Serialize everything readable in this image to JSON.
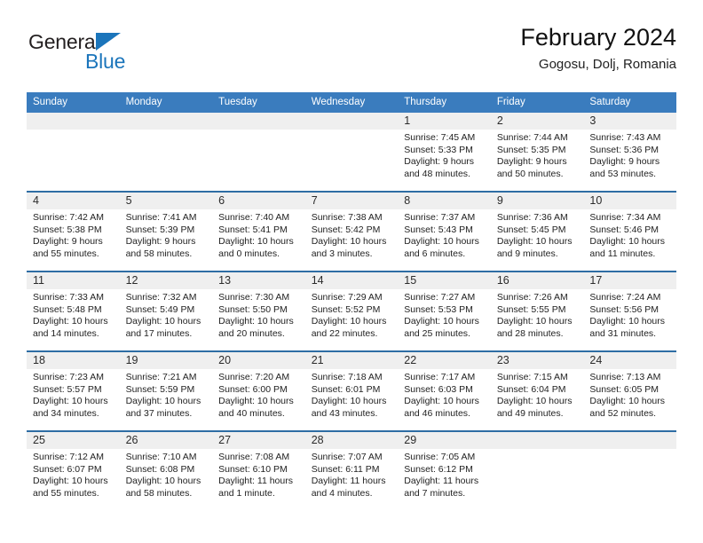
{
  "brand": {
    "word_one": "General",
    "word_two": "Blue",
    "triangle_icon": "triangle-icon",
    "accent_color": "#1b75bb"
  },
  "header": {
    "title": "February 2024",
    "location": "Gogosu, Dolj, Romania"
  },
  "theme": {
    "header_blue": "#3a7cbe",
    "row_rule_blue": "#2e6da4",
    "daynum_band": "#efefef"
  },
  "weekday_headers": [
    "Sunday",
    "Monday",
    "Tuesday",
    "Wednesday",
    "Thursday",
    "Friday",
    "Saturday"
  ],
  "weeks": [
    [
      {
        "day": "",
        "sunrise": "",
        "sunset": "",
        "daylight_1": "",
        "daylight_2": "",
        "empty": true
      },
      {
        "day": "",
        "sunrise": "",
        "sunset": "",
        "daylight_1": "",
        "daylight_2": "",
        "empty": true
      },
      {
        "day": "",
        "sunrise": "",
        "sunset": "",
        "daylight_1": "",
        "daylight_2": "",
        "empty": true
      },
      {
        "day": "",
        "sunrise": "",
        "sunset": "",
        "daylight_1": "",
        "daylight_2": "",
        "empty": true
      },
      {
        "day": "1",
        "sunrise": "Sunrise: 7:45 AM",
        "sunset": "Sunset: 5:33 PM",
        "daylight_1": "Daylight: 9 hours",
        "daylight_2": "and 48 minutes."
      },
      {
        "day": "2",
        "sunrise": "Sunrise: 7:44 AM",
        "sunset": "Sunset: 5:35 PM",
        "daylight_1": "Daylight: 9 hours",
        "daylight_2": "and 50 minutes."
      },
      {
        "day": "3",
        "sunrise": "Sunrise: 7:43 AM",
        "sunset": "Sunset: 5:36 PM",
        "daylight_1": "Daylight: 9 hours",
        "daylight_2": "and 53 minutes."
      }
    ],
    [
      {
        "day": "4",
        "sunrise": "Sunrise: 7:42 AM",
        "sunset": "Sunset: 5:38 PM",
        "daylight_1": "Daylight: 9 hours",
        "daylight_2": "and 55 minutes."
      },
      {
        "day": "5",
        "sunrise": "Sunrise: 7:41 AM",
        "sunset": "Sunset: 5:39 PM",
        "daylight_1": "Daylight: 9 hours",
        "daylight_2": "and 58 minutes."
      },
      {
        "day": "6",
        "sunrise": "Sunrise: 7:40 AM",
        "sunset": "Sunset: 5:41 PM",
        "daylight_1": "Daylight: 10 hours",
        "daylight_2": "and 0 minutes."
      },
      {
        "day": "7",
        "sunrise": "Sunrise: 7:38 AM",
        "sunset": "Sunset: 5:42 PM",
        "daylight_1": "Daylight: 10 hours",
        "daylight_2": "and 3 minutes."
      },
      {
        "day": "8",
        "sunrise": "Sunrise: 7:37 AM",
        "sunset": "Sunset: 5:43 PM",
        "daylight_1": "Daylight: 10 hours",
        "daylight_2": "and 6 minutes."
      },
      {
        "day": "9",
        "sunrise": "Sunrise: 7:36 AM",
        "sunset": "Sunset: 5:45 PM",
        "daylight_1": "Daylight: 10 hours",
        "daylight_2": "and 9 minutes."
      },
      {
        "day": "10",
        "sunrise": "Sunrise: 7:34 AM",
        "sunset": "Sunset: 5:46 PM",
        "daylight_1": "Daylight: 10 hours",
        "daylight_2": "and 11 minutes."
      }
    ],
    [
      {
        "day": "11",
        "sunrise": "Sunrise: 7:33 AM",
        "sunset": "Sunset: 5:48 PM",
        "daylight_1": "Daylight: 10 hours",
        "daylight_2": "and 14 minutes."
      },
      {
        "day": "12",
        "sunrise": "Sunrise: 7:32 AM",
        "sunset": "Sunset: 5:49 PM",
        "daylight_1": "Daylight: 10 hours",
        "daylight_2": "and 17 minutes."
      },
      {
        "day": "13",
        "sunrise": "Sunrise: 7:30 AM",
        "sunset": "Sunset: 5:50 PM",
        "daylight_1": "Daylight: 10 hours",
        "daylight_2": "and 20 minutes."
      },
      {
        "day": "14",
        "sunrise": "Sunrise: 7:29 AM",
        "sunset": "Sunset: 5:52 PM",
        "daylight_1": "Daylight: 10 hours",
        "daylight_2": "and 22 minutes."
      },
      {
        "day": "15",
        "sunrise": "Sunrise: 7:27 AM",
        "sunset": "Sunset: 5:53 PM",
        "daylight_1": "Daylight: 10 hours",
        "daylight_2": "and 25 minutes."
      },
      {
        "day": "16",
        "sunrise": "Sunrise: 7:26 AM",
        "sunset": "Sunset: 5:55 PM",
        "daylight_1": "Daylight: 10 hours",
        "daylight_2": "and 28 minutes."
      },
      {
        "day": "17",
        "sunrise": "Sunrise: 7:24 AM",
        "sunset": "Sunset: 5:56 PM",
        "daylight_1": "Daylight: 10 hours",
        "daylight_2": "and 31 minutes."
      }
    ],
    [
      {
        "day": "18",
        "sunrise": "Sunrise: 7:23 AM",
        "sunset": "Sunset: 5:57 PM",
        "daylight_1": "Daylight: 10 hours",
        "daylight_2": "and 34 minutes."
      },
      {
        "day": "19",
        "sunrise": "Sunrise: 7:21 AM",
        "sunset": "Sunset: 5:59 PM",
        "daylight_1": "Daylight: 10 hours",
        "daylight_2": "and 37 minutes."
      },
      {
        "day": "20",
        "sunrise": "Sunrise: 7:20 AM",
        "sunset": "Sunset: 6:00 PM",
        "daylight_1": "Daylight: 10 hours",
        "daylight_2": "and 40 minutes."
      },
      {
        "day": "21",
        "sunrise": "Sunrise: 7:18 AM",
        "sunset": "Sunset: 6:01 PM",
        "daylight_1": "Daylight: 10 hours",
        "daylight_2": "and 43 minutes."
      },
      {
        "day": "22",
        "sunrise": "Sunrise: 7:17 AM",
        "sunset": "Sunset: 6:03 PM",
        "daylight_1": "Daylight: 10 hours",
        "daylight_2": "and 46 minutes."
      },
      {
        "day": "23",
        "sunrise": "Sunrise: 7:15 AM",
        "sunset": "Sunset: 6:04 PM",
        "daylight_1": "Daylight: 10 hours",
        "daylight_2": "and 49 minutes."
      },
      {
        "day": "24",
        "sunrise": "Sunrise: 7:13 AM",
        "sunset": "Sunset: 6:05 PM",
        "daylight_1": "Daylight: 10 hours",
        "daylight_2": "and 52 minutes."
      }
    ],
    [
      {
        "day": "25",
        "sunrise": "Sunrise: 7:12 AM",
        "sunset": "Sunset: 6:07 PM",
        "daylight_1": "Daylight: 10 hours",
        "daylight_2": "and 55 minutes."
      },
      {
        "day": "26",
        "sunrise": "Sunrise: 7:10 AM",
        "sunset": "Sunset: 6:08 PM",
        "daylight_1": "Daylight: 10 hours",
        "daylight_2": "and 58 minutes."
      },
      {
        "day": "27",
        "sunrise": "Sunrise: 7:08 AM",
        "sunset": "Sunset: 6:10 PM",
        "daylight_1": "Daylight: 11 hours",
        "daylight_2": "and 1 minute."
      },
      {
        "day": "28",
        "sunrise": "Sunrise: 7:07 AM",
        "sunset": "Sunset: 6:11 PM",
        "daylight_1": "Daylight: 11 hours",
        "daylight_2": "and 4 minutes."
      },
      {
        "day": "29",
        "sunrise": "Sunrise: 7:05 AM",
        "sunset": "Sunset: 6:12 PM",
        "daylight_1": "Daylight: 11 hours",
        "daylight_2": "and 7 minutes."
      },
      {
        "day": "",
        "sunrise": "",
        "sunset": "",
        "daylight_1": "",
        "daylight_2": "",
        "empty": true
      },
      {
        "day": "",
        "sunrise": "",
        "sunset": "",
        "daylight_1": "",
        "daylight_2": "",
        "empty": true
      }
    ]
  ]
}
